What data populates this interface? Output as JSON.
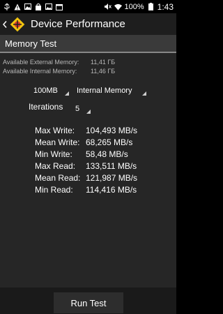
{
  "status_bar": {
    "battery": "100%",
    "time": "1:43"
  },
  "action_bar": {
    "title": "Device Performance"
  },
  "section": {
    "title": "Memory Test"
  },
  "memory_info": [
    {
      "label": "Available External Memory:",
      "value": "11,41 ГБ"
    },
    {
      "label": "Available Internal Memory:",
      "value": "11,46 ГБ"
    }
  ],
  "options": {
    "size": "100MB",
    "location": "Internal Memory",
    "iterations_label": "Iterations",
    "iterations": "5"
  },
  "results": [
    {
      "label": "Max Write:",
      "value": "104,493 MB/s"
    },
    {
      "label": "Mean Write:",
      "value": "68,265 MB/s"
    },
    {
      "label": "Min Write:",
      "value": "58,48 MB/s"
    },
    {
      "label": "Max Read:",
      "value": "133,511 MB/s"
    },
    {
      "label": "Mean Read:",
      "value": "121,987 MB/s"
    },
    {
      "label": "Min Read:",
      "value": "114,416 MB/s"
    }
  ],
  "run_button": "Run Test"
}
